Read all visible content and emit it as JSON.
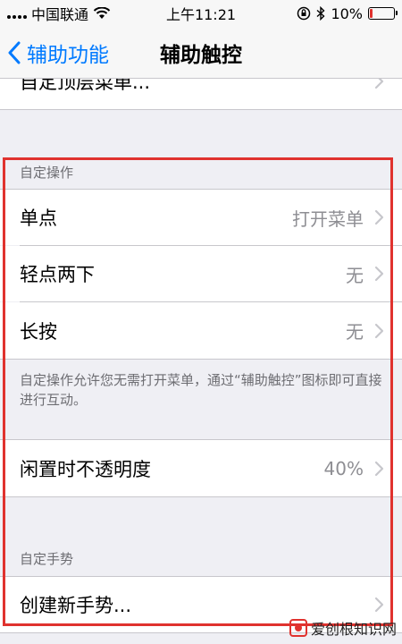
{
  "status_bar": {
    "carrier": "中国联通",
    "time": "上午11:21",
    "battery_percent": "10%",
    "battery_level": 0.1,
    "battery_color": "#e0322e"
  },
  "nav": {
    "back_label": "辅助功能",
    "title": "辅助触控",
    "accent": "#007aff"
  },
  "top_cell": {
    "label": "自定顶层菜单..."
  },
  "custom_actions": {
    "header": "自定操作",
    "items": [
      {
        "label": "单点",
        "value": "打开菜单"
      },
      {
        "label": "轻点两下",
        "value": "无"
      },
      {
        "label": "长按",
        "value": "无"
      }
    ],
    "footnote": "自定操作允许您无需打开菜单，通过“辅助触控”图标即可直接进行互动。"
  },
  "idle_opacity": {
    "label": "闲置时不透明度",
    "value": "40%"
  },
  "custom_gestures": {
    "header": "自定手势",
    "create_label": "创建新手势..."
  },
  "watermark": {
    "text": "爱创根知识网"
  },
  "icons": {
    "back": "chevron-left-icon",
    "chevron": "chevron-right-icon",
    "wifi": "wifi-icon",
    "lock_rotation": "orientation-lock-icon",
    "bluetooth": "bluetooth-icon",
    "battery": "battery-icon"
  }
}
